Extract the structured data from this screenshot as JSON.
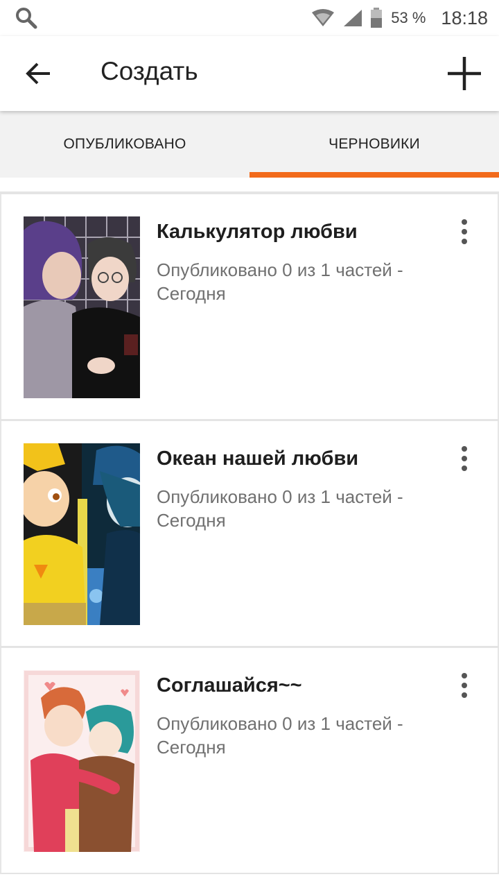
{
  "status_bar": {
    "battery": "53 %",
    "time": "18:18",
    "icons": [
      "search-icon",
      "wifi-icon",
      "signal-icon",
      "battery-icon"
    ]
  },
  "app_bar": {
    "title": "Создать",
    "back_icon": "arrow-left-icon",
    "add_icon": "plus-icon"
  },
  "tabs": [
    {
      "label": "ОПУБЛИКОВАНО",
      "active": false
    },
    {
      "label": "ЧЕРНОВИКИ",
      "active": true
    }
  ],
  "accent_color": "#f26a1b",
  "stories": [
    {
      "title": "Калькулятор любви",
      "status": "Опубликовано 0 из 1 частей - Сегодня"
    },
    {
      "title": "Океан нашей любви",
      "status": "Опубликовано 0 из 1 частей - Сегодня"
    },
    {
      "title": "Соглашайся~~",
      "status": "Опубликовано 0 из 1 частей - Сегодня"
    }
  ]
}
